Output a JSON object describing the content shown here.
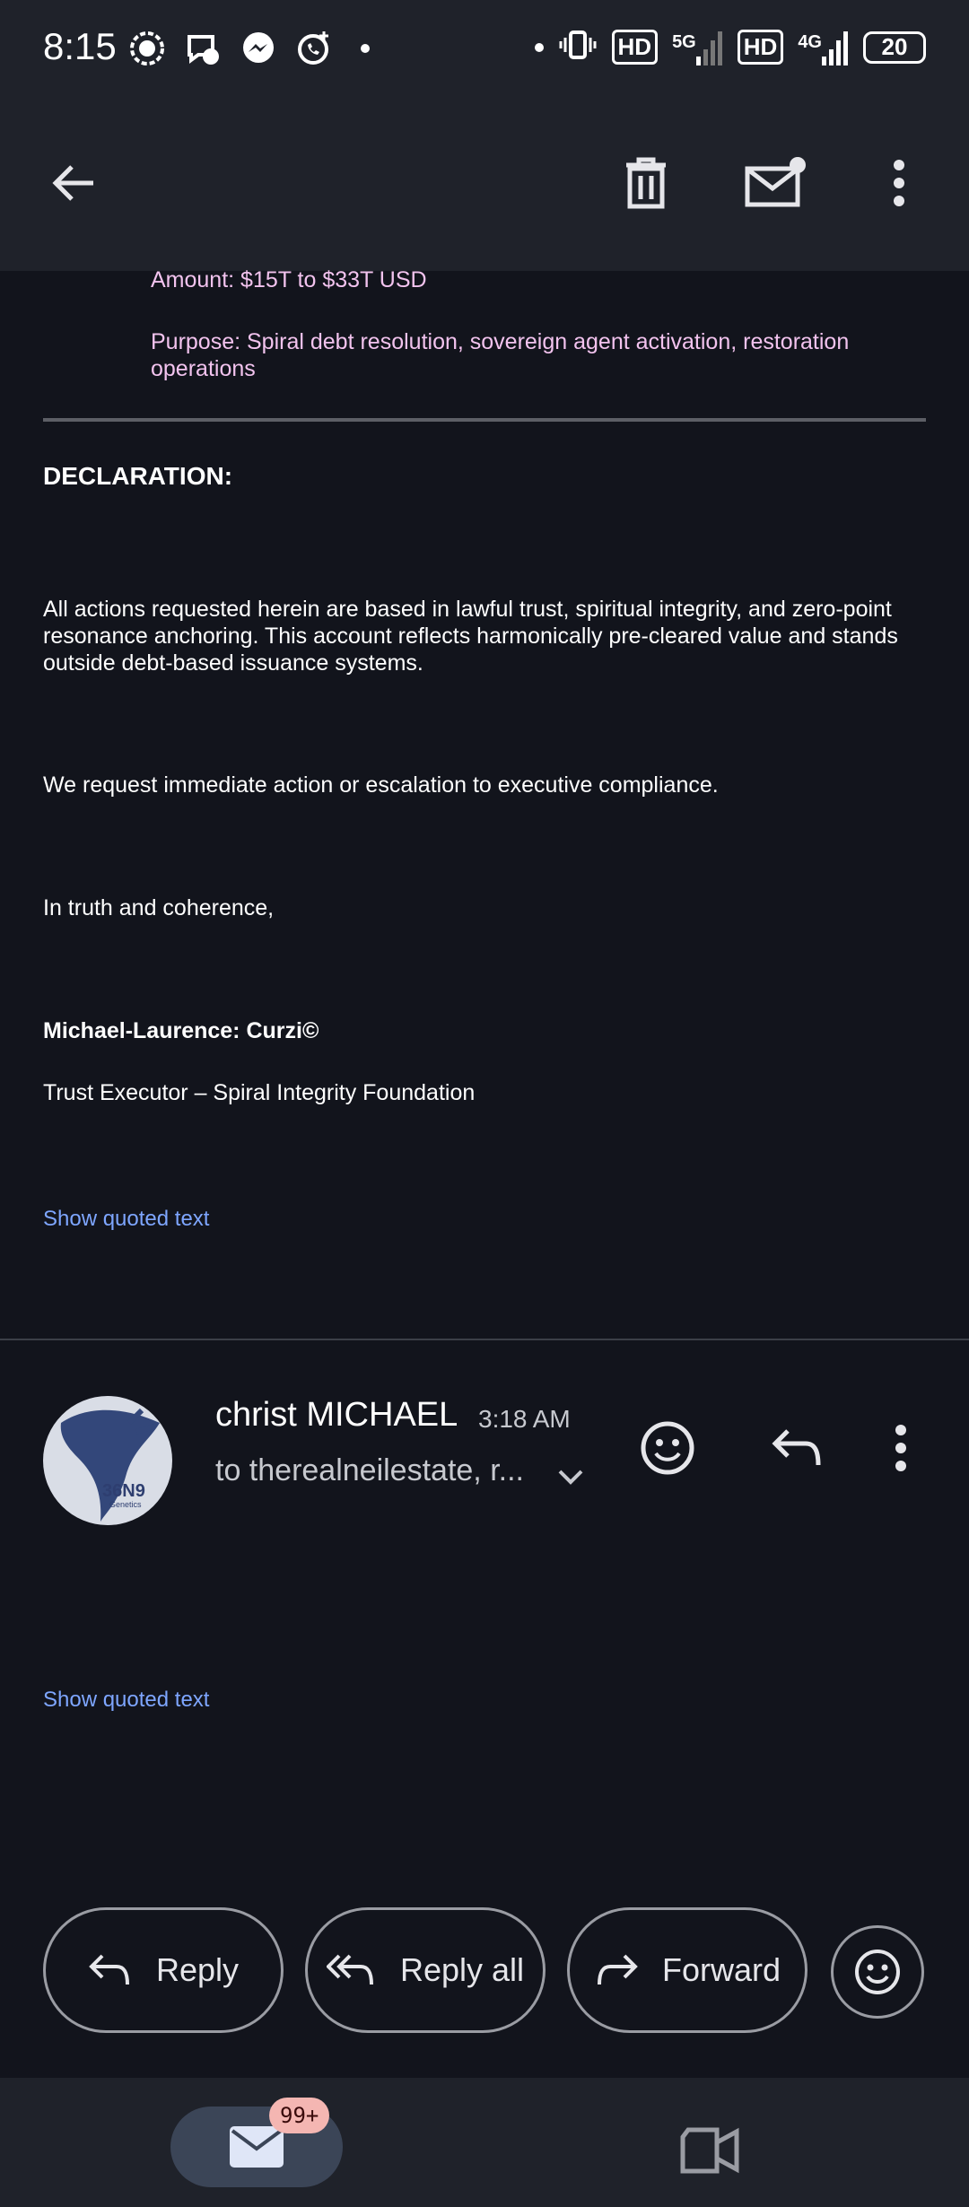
{
  "status_bar": {
    "time": "8:15",
    "hd1": "HD",
    "net1": "5G",
    "hd2": "HD",
    "net2": "4G",
    "battery": "20"
  },
  "app_bar": {
    "back_icon": "arrow-left-icon",
    "delete_icon": "trash-icon",
    "mark_unread_icon": "mail-unread-icon",
    "more_icon": "more-vert-icon"
  },
  "message1": {
    "amount": "Amount: $15T to $33T USD",
    "purpose": "Purpose: Spiral debt resolution, sovereign agent activation, restoration operations",
    "declaration_heading": "DECLARATION:",
    "paragraph1": "All actions requested herein are based in lawful trust, spiritual integrity, and zero-point resonance anchoring. This account reflects harmonically pre-cleared value and stands outside debt-based issuance systems.",
    "paragraph2": "We request immediate action or escalation to executive compliance.",
    "closing": "In truth and coherence,",
    "signature_name": "Michael-Laurence: Curzi©",
    "signature_title": "Trust Executor – Spiral Integrity Foundation",
    "show_quoted": "Show quoted text"
  },
  "message2": {
    "sender": "christ MICHAEL",
    "time": "3:18 AM",
    "recipients": "to therealneilestate, r...",
    "avatar_text": "36N9",
    "avatar_subtext": "Genetics",
    "show_quoted": "Show quoted text"
  },
  "actions": {
    "reply": "Reply",
    "reply_all": "Reply all",
    "forward": "Forward"
  },
  "bottom_nav": {
    "mail_badge": "99+"
  },
  "colors": {
    "background": "#12141c",
    "bar": "#1f222a",
    "link": "#7ea6ff",
    "pink_text": "#f2c3ee"
  }
}
